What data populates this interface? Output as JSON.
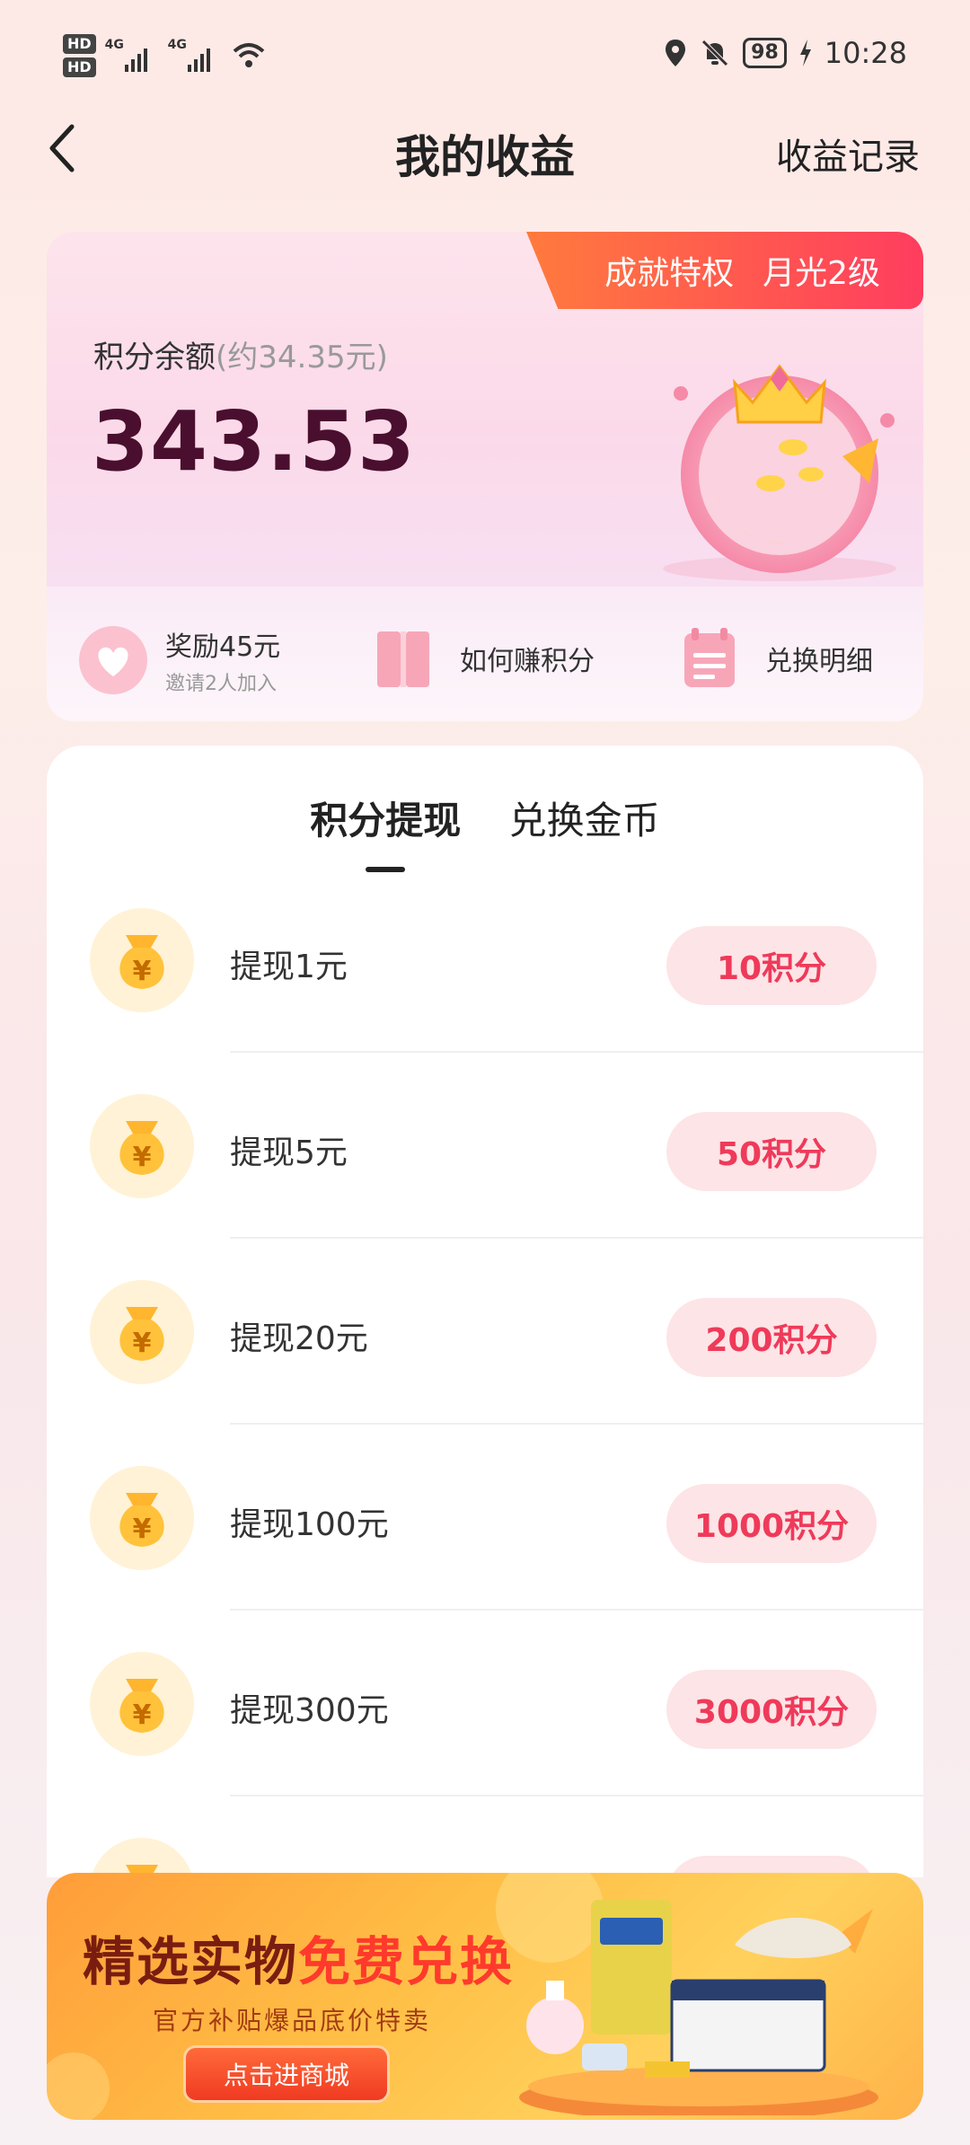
{
  "status_bar": {
    "sim1": "HD",
    "sim2": "HD",
    "network1": "4G",
    "network2": "4G",
    "battery": "98",
    "time": "10:28"
  },
  "header": {
    "title": "我的收益",
    "records": "收益记录"
  },
  "card": {
    "badge_left": "成就特权",
    "badge_right": "月光2级",
    "balance_label": "积分余额",
    "balance_approx": "(约34.35元)",
    "balance_value": "343.53",
    "quick": [
      {
        "main": "奖励45元",
        "sub": "邀请2人加入"
      },
      {
        "main": "如何赚积分"
      },
      {
        "main": "兑换明细"
      }
    ]
  },
  "tabs": [
    "积分提现",
    "兑换金币"
  ],
  "rows": [
    {
      "label": "提现1元",
      "cost": "10积分"
    },
    {
      "label": "提现5元",
      "cost": "50积分"
    },
    {
      "label": "提现20元",
      "cost": "200积分"
    },
    {
      "label": "提现100元",
      "cost": "1000积分"
    },
    {
      "label": "提现300元",
      "cost": "3000积分"
    }
  ],
  "banner": {
    "title_a": "精选实物",
    "title_b": "免费兑换",
    "subtitle": "官方补贴爆品底价特卖",
    "button": "点击进商城"
  },
  "colors": {
    "accent": "#ef3a5a",
    "badge_start": "#ff7a3d",
    "badge_end": "#ff3d5f",
    "balance": "#4a0f2e"
  }
}
